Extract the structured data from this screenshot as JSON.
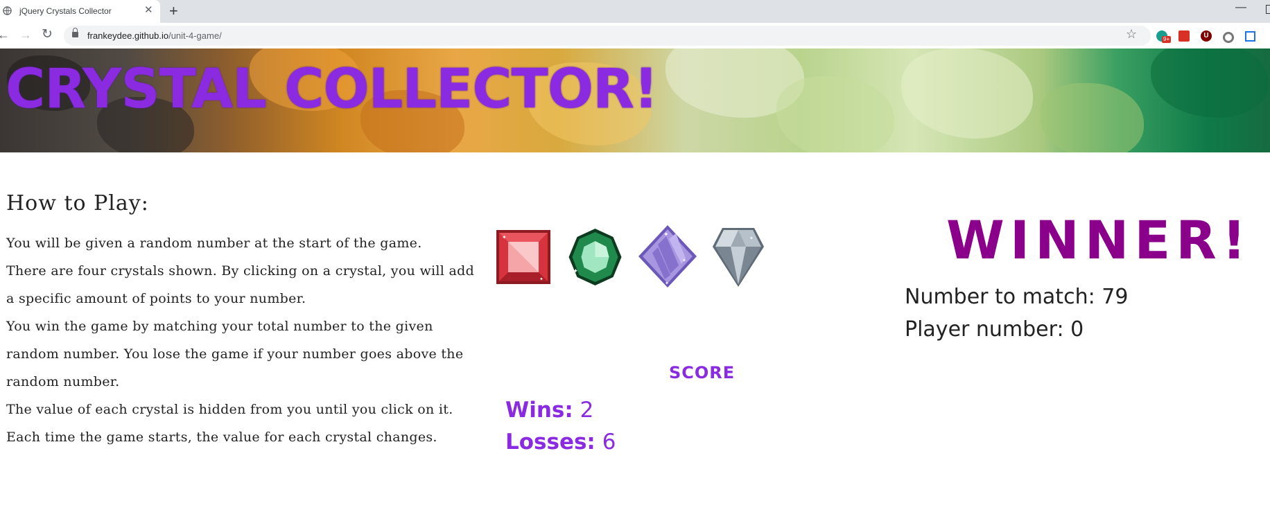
{
  "browser": {
    "tab_title": "jQuery Crystals Collector",
    "url_domain": "frankeydee.github.io",
    "url_path": "/unit-4-game/",
    "extension_badge": "9+",
    "extension_3_letter": "U"
  },
  "banner": {
    "title": "CRYSTAL COLLECTOR!"
  },
  "instructions": {
    "heading": "How to Play:",
    "paragraphs": [
      "You will be given a random number at the start of the game.",
      "There are four crystals shown. By clicking on a crystal, you will add a specific amount of points to your number.",
      "You win the game by matching your total number to the given random number. You lose the game if your number goes above the random number.",
      "The value of each crystal is hidden from you until you click on it.",
      "Each time the game starts, the value for each crystal changes."
    ]
  },
  "crystals": [
    {
      "icon": "red-ruby-crystal",
      "color": "#d32f3a"
    },
    {
      "icon": "green-emerald-crystal",
      "color": "#1f8a4c"
    },
    {
      "icon": "purple-amethyst-crystal",
      "color": "#9b87d6"
    },
    {
      "icon": "white-diamond-crystal",
      "color": "#8e9aa6"
    }
  ],
  "score": {
    "title": "SCORE",
    "wins_label": "Wins:",
    "wins_value": "2",
    "losses_label": "Losses:",
    "losses_value": "6"
  },
  "status": {
    "message": "WINNER!",
    "target_label": "Number to match:",
    "target_value": "79",
    "player_label": "Player number:",
    "player_value": "0"
  },
  "colors": {
    "title_purple": "#8a2be2",
    "winner_magenta": "#8b008b"
  }
}
